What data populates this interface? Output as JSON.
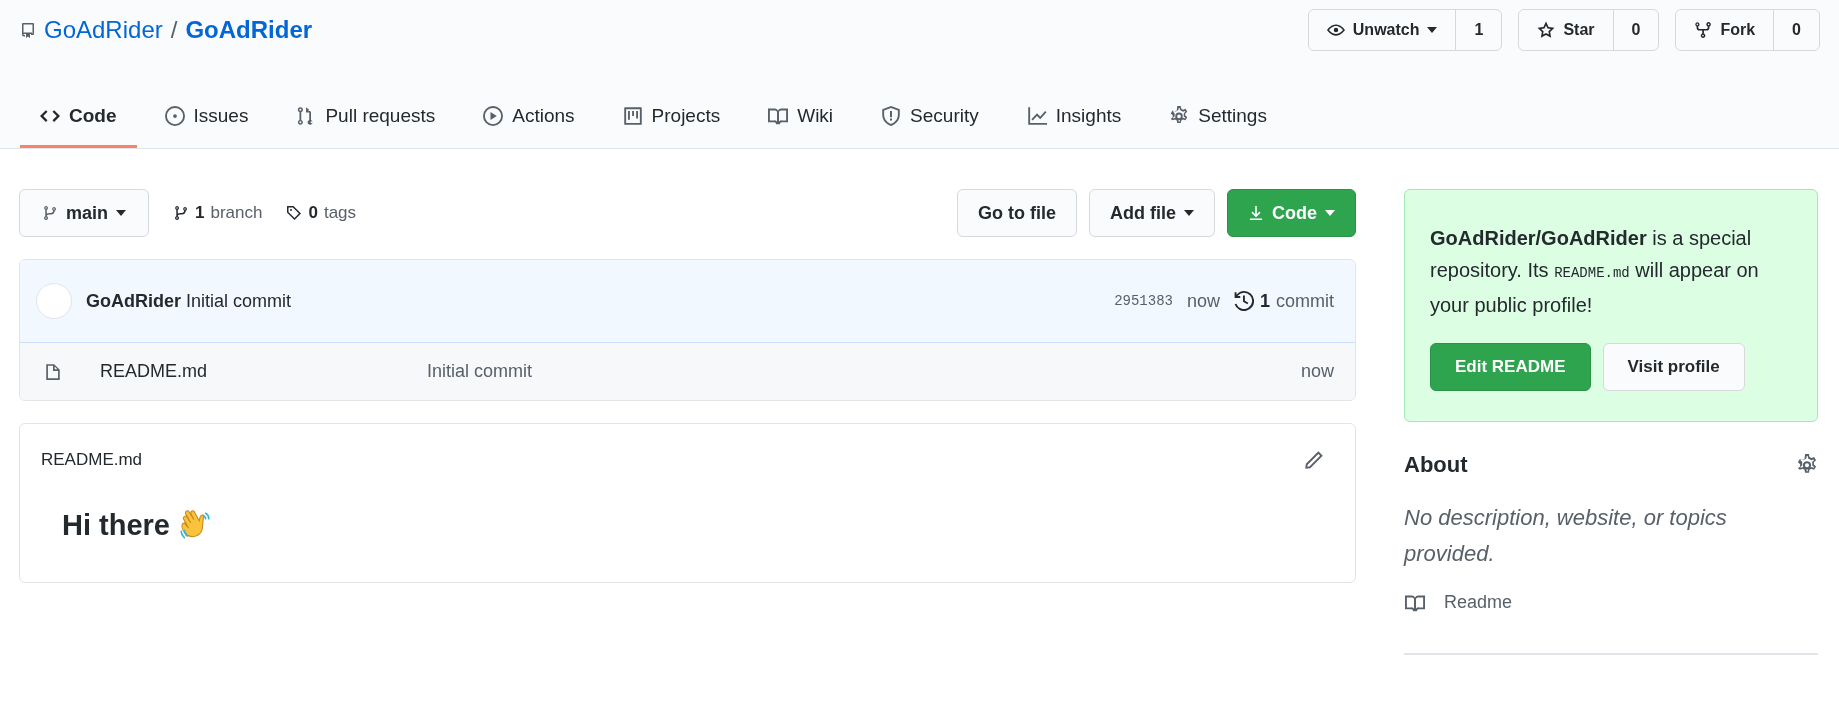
{
  "repo": {
    "owner": "GoAdRider",
    "separator": "/",
    "name": "GoAdRider"
  },
  "social": [
    {
      "kind": "watch",
      "label": "Unwatch",
      "dropdown": true,
      "count": "1"
    },
    {
      "kind": "star",
      "label": "Star",
      "dropdown": false,
      "count": "0"
    },
    {
      "kind": "fork",
      "label": "Fork",
      "dropdown": false,
      "count": "0"
    }
  ],
  "tabs": [
    {
      "kind": "code",
      "label": "Code",
      "selected": true
    },
    {
      "kind": "issues",
      "label": "Issues",
      "selected": false
    },
    {
      "kind": "pulls",
      "label": "Pull requests",
      "selected": false
    },
    {
      "kind": "actions",
      "label": "Actions",
      "selected": false
    },
    {
      "kind": "projects",
      "label": "Projects",
      "selected": false
    },
    {
      "kind": "wiki",
      "label": "Wiki",
      "selected": false
    },
    {
      "kind": "security",
      "label": "Security",
      "selected": false
    },
    {
      "kind": "insights",
      "label": "Insights",
      "selected": false
    },
    {
      "kind": "settings",
      "label": "Settings",
      "selected": false
    }
  ],
  "branch": {
    "name": "main"
  },
  "counts": [
    {
      "kind": "branch",
      "count": "1",
      "label": "branch"
    },
    {
      "kind": "tag",
      "count": "0",
      "label": "tags"
    }
  ],
  "file_buttons": [
    {
      "kind": "plain",
      "label": "Go to file"
    },
    {
      "kind": "dropdown",
      "label": "Add file"
    },
    {
      "kind": "primary",
      "label": "Code"
    }
  ],
  "latest_commit": {
    "author": "GoAdRider",
    "message": "Initial commit",
    "sha": "2951383",
    "time": "now",
    "history_count": "1",
    "history_label": "commit"
  },
  "files": [
    {
      "name": "README.md",
      "message": "Initial commit",
      "time": "now"
    }
  ],
  "readme": {
    "title": "README.md",
    "heading": "Hi there"
  },
  "notice": {
    "segments": [
      {
        "kind": "bold",
        "text": "GoAdRider/GoAdRider"
      },
      {
        "kind": "plain",
        "text": " is a special repository. Its "
      },
      {
        "kind": "code",
        "text": "README.md"
      },
      {
        "kind": "plain",
        "text": " will appear on your public profile!"
      }
    ],
    "buttons": [
      {
        "kind": "primary",
        "label": "Edit README"
      },
      {
        "kind": "plain",
        "label": "Visit profile"
      }
    ]
  },
  "about": {
    "title": "About",
    "description": "No description, website, or topics provided.",
    "links": [
      {
        "kind": "readme",
        "label": "Readme"
      }
    ]
  }
}
